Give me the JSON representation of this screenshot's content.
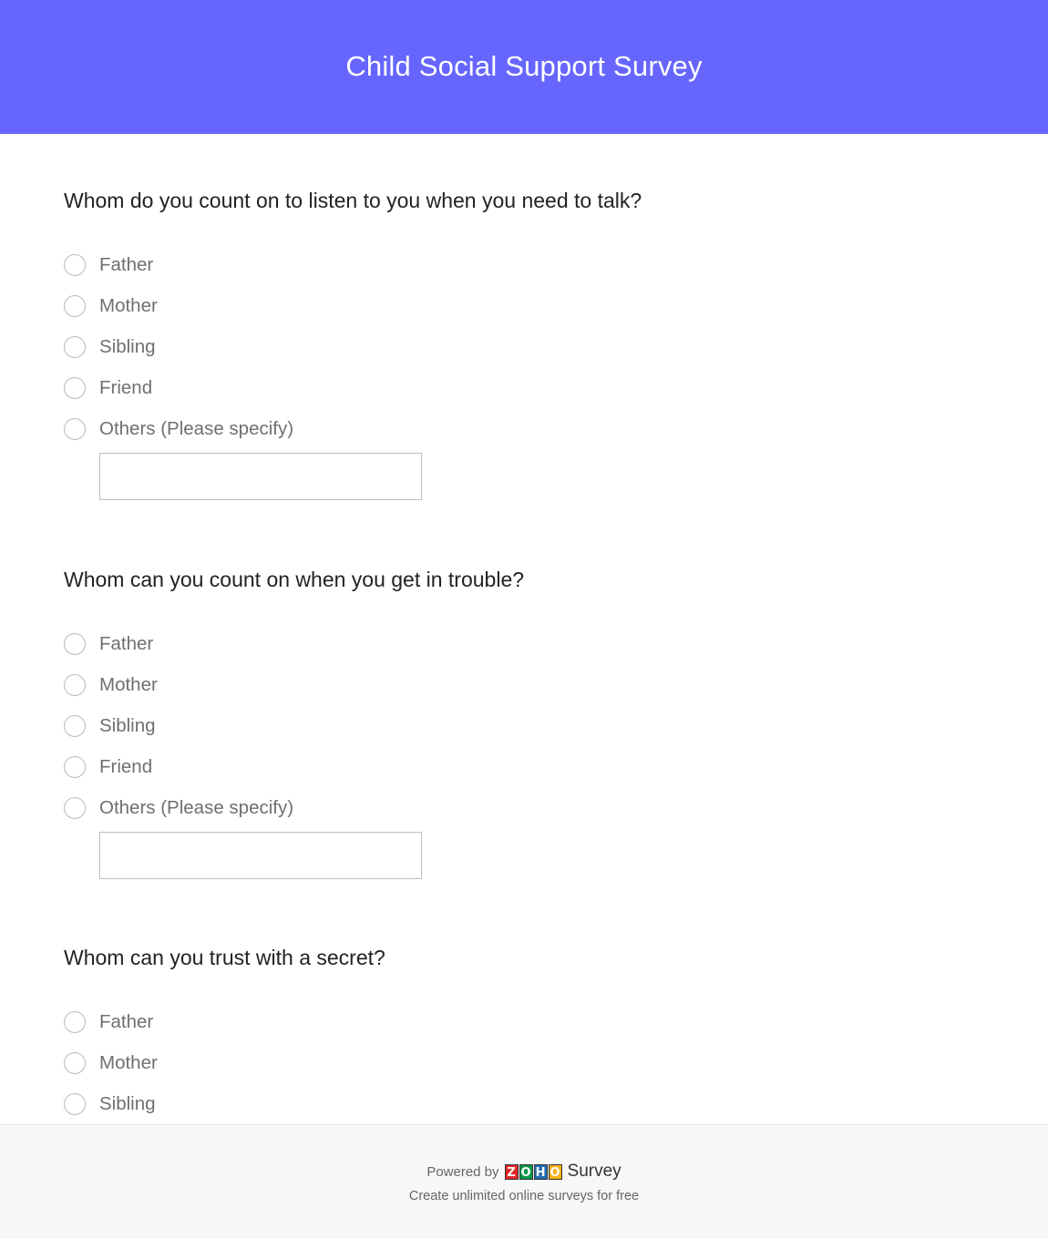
{
  "header": {
    "title": "Child Social Support Survey",
    "background_color": "#6666ff"
  },
  "questions": [
    {
      "label": "Whom do you count on to listen to you when you need to talk?",
      "options": [
        "Father",
        "Mother",
        "Sibling",
        "Friend",
        "Others (Please specify)"
      ],
      "specify_value": ""
    },
    {
      "label": "Whom can you count on when you get in trouble?",
      "options": [
        "Father",
        "Mother",
        "Sibling",
        "Friend",
        "Others (Please specify)"
      ],
      "specify_value": ""
    },
    {
      "label": "Whom can you trust with a secret?",
      "options": [
        "Father",
        "Mother",
        "Sibling"
      ]
    }
  ],
  "footer": {
    "powered_by": "Powered by",
    "logo_letters": [
      {
        "letter": "Z",
        "color": "#e42527"
      },
      {
        "letter": "O",
        "color": "#089949"
      },
      {
        "letter": "H",
        "color": "#226db4"
      },
      {
        "letter": "O",
        "color": "#f9b21d"
      }
    ],
    "logo_product": "Survey",
    "tagline": "Create unlimited online surveys for free"
  }
}
